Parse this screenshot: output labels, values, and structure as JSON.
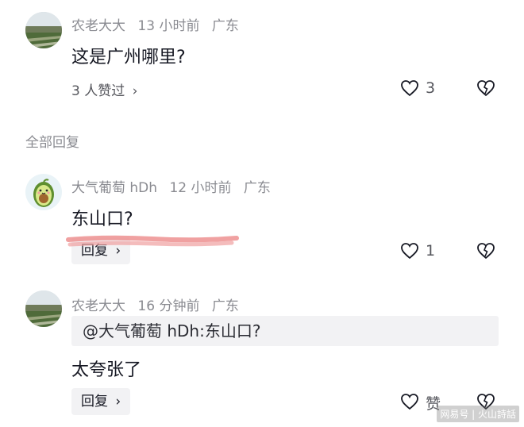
{
  "comment1": {
    "avatar": "field-landscape-avatar",
    "username": "农老大大",
    "time": "13 小时前",
    "location": "广东",
    "text": "这是广州哪里?",
    "likes_summary": "3 人赞过",
    "like_count": "3"
  },
  "section": {
    "all_replies_label": "全部回复"
  },
  "comment2": {
    "avatar": "avocado-avatar",
    "username": "大气葡萄 hDh",
    "time": "12 小时前",
    "location": "广东",
    "text": "东山口?",
    "reply_label": "回复",
    "like_count": "1"
  },
  "comment3": {
    "avatar": "field-landscape-avatar",
    "username": "农老大大",
    "time": "16 分钟前",
    "location": "广东",
    "quote": "@大气葡萄 hDh:东山口?",
    "text": "太夸张了",
    "reply_label": "回复",
    "like_label": "赞"
  },
  "watermark": "网易号 | 火山詩話",
  "icons": {
    "like": "heart-outline-icon",
    "dislike": "broken-heart-icon",
    "chevron": "chevron-right-icon"
  }
}
